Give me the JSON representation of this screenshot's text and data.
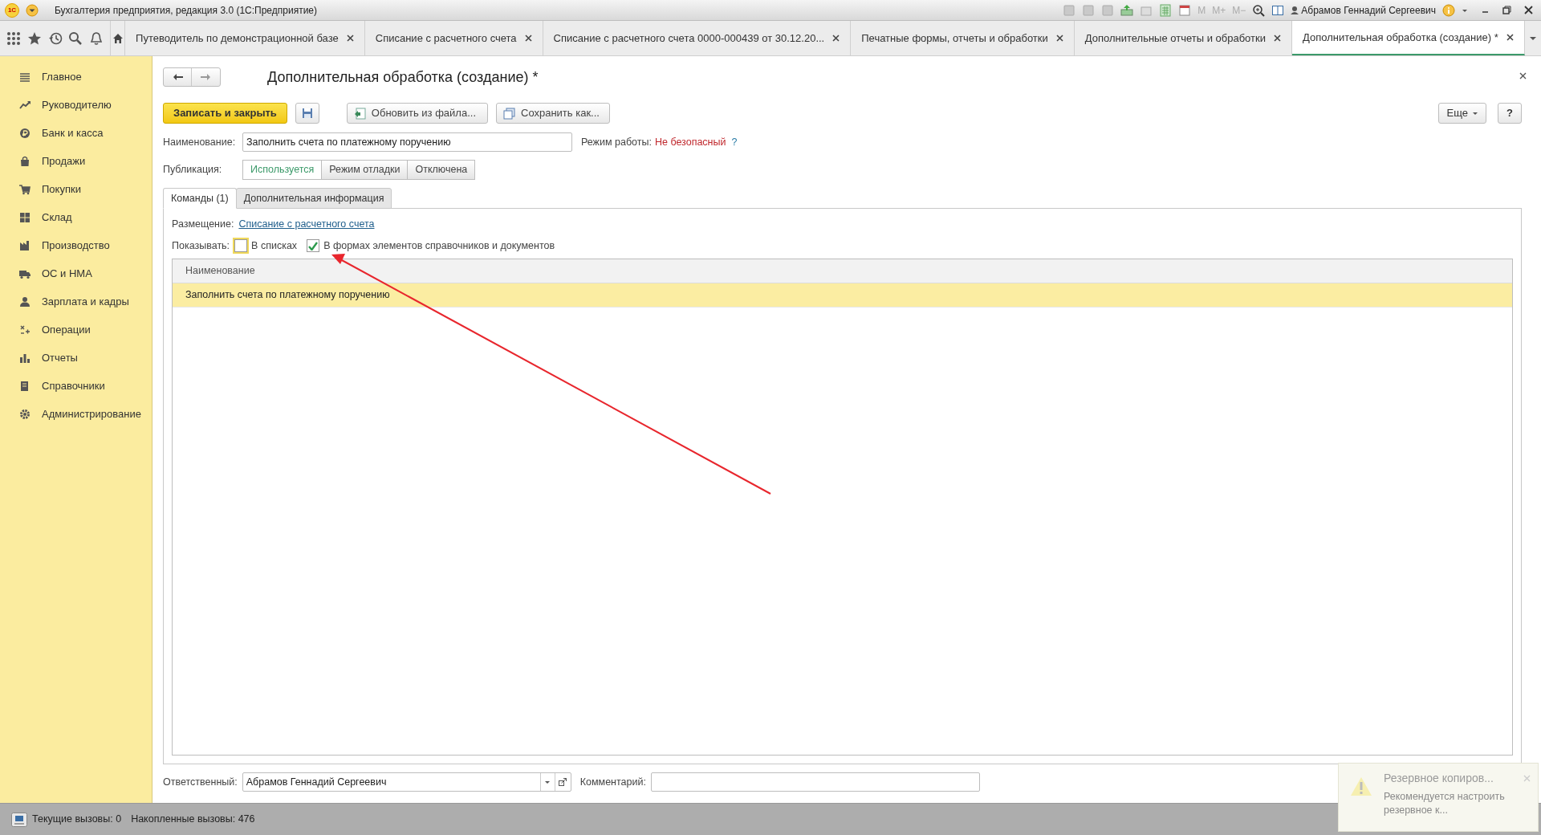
{
  "window": {
    "logo": "1С",
    "title": "Бухгалтерия предприятия, редакция 3.0  (1С:Предприятие)",
    "memory_buttons": [
      "M",
      "M+",
      "M−"
    ],
    "user": "Абрамов Геннадий Сергеевич"
  },
  "tabs": [
    {
      "label": "Путеводитель по демонстрационной базе",
      "selected": false
    },
    {
      "label": "Списание с расчетного счета",
      "selected": false
    },
    {
      "label": "Списание с расчетного счета 0000-000439 от 30.12.20...",
      "selected": false
    },
    {
      "label": "Печатные формы, отчеты и обработки",
      "selected": false
    },
    {
      "label": "Дополнительные отчеты и обработки",
      "selected": false
    },
    {
      "label": "Дополнительная обработка (создание) *",
      "selected": true
    }
  ],
  "sidebar": {
    "items": [
      {
        "label": "Главное"
      },
      {
        "label": "Руководителю"
      },
      {
        "label": "Банк и касса"
      },
      {
        "label": "Продажи"
      },
      {
        "label": "Покупки"
      },
      {
        "label": "Склад"
      },
      {
        "label": "Производство"
      },
      {
        "label": "ОС и НМА"
      },
      {
        "label": "Зарплата и кадры"
      },
      {
        "label": "Операции"
      },
      {
        "label": "Отчеты"
      },
      {
        "label": "Справочники"
      },
      {
        "label": "Администрирование"
      }
    ]
  },
  "form": {
    "title": "Дополнительная обработка (создание) *",
    "primary_button": "Записать и закрыть",
    "buttons": [
      "Обновить из файла...",
      "Сохранить как..."
    ],
    "more_button": "Еще",
    "help_button": "?",
    "name_label": "Наименование:",
    "name_value": "Заполнить счета по платежному поручению",
    "mode_label": "Режим работы:",
    "mode_value": "Не безопасный",
    "mode_help": "?",
    "publication_label": "Публикация:",
    "publication_options": [
      {
        "label": "Используется",
        "selected": true
      },
      {
        "label": "Режим отладки",
        "selected": false
      },
      {
        "label": "Отключена",
        "selected": false
      }
    ],
    "inner_tabs": [
      {
        "label": "Команды (1)",
        "selected": true
      },
      {
        "label": "Дополнительная информация",
        "selected": false
      }
    ],
    "placement_label": "Размещение:",
    "placement_link": "Списание с расчетного счета",
    "show_label": "Показывать:",
    "show_options": [
      {
        "label": "В списках",
        "checked": false
      },
      {
        "label": "В формах элементов справочников и документов",
        "checked": true
      }
    ],
    "table": {
      "columns": [
        "Наименование"
      ],
      "rows": [
        {
          "cells": [
            "Заполнить счета по платежному поручению"
          ],
          "selected": true
        }
      ]
    },
    "responsible_label": "Ответственный:",
    "responsible_value": "Абрамов Геннадий Сергеевич",
    "comment_label": "Комментарий:"
  },
  "status_bar": {
    "current_calls": "Текущие вызовы: 0",
    "accumulated_calls": "Накопленные вызовы: 476"
  },
  "notification": {
    "title": "Резервное копиров...",
    "text": "Рекомендуется настроить резервное к..."
  }
}
